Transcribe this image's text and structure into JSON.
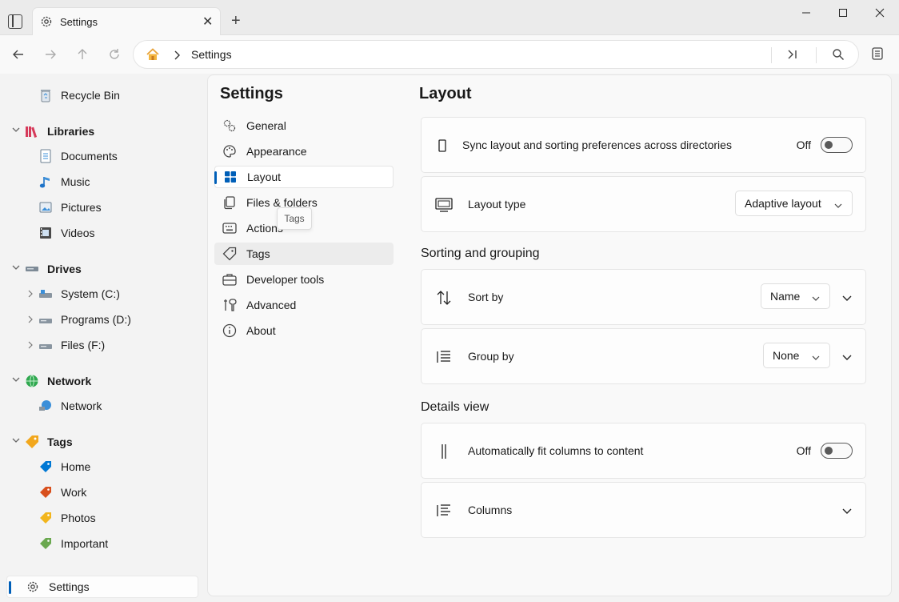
{
  "titlebar": {
    "tab_label": "Settings",
    "close_glyph": "✕",
    "new_tab_glyph": "+"
  },
  "window": {
    "min_glyph": "—",
    "max_glyph": "☐",
    "close_glyph": "✕"
  },
  "address": {
    "crumb": "Settings"
  },
  "sidebar": {
    "recycle_bin": "Recycle Bin",
    "libraries": {
      "label": "Libraries",
      "items": [
        "Documents",
        "Music",
        "Pictures",
        "Videos"
      ]
    },
    "drives": {
      "label": "Drives",
      "items": [
        "System (C:)",
        "Programs (D:)",
        "Files (F:)"
      ]
    },
    "network": {
      "label": "Network",
      "items": [
        "Network"
      ]
    },
    "tags": {
      "label": "Tags",
      "items": [
        "Home",
        "Work",
        "Photos",
        "Important"
      ]
    },
    "settings": "Settings"
  },
  "settings_nav": {
    "title": "Settings",
    "items": [
      "General",
      "Appearance",
      "Layout",
      "Files & folders",
      "Actions",
      "Tags",
      "Developer tools",
      "Advanced",
      "About"
    ],
    "tooltip": "Tags"
  },
  "layout_page": {
    "title": "Layout",
    "sync": {
      "label": "Sync layout and sorting preferences across directories",
      "state": "Off"
    },
    "layout_type": {
      "label": "Layout type",
      "value": "Adaptive layout"
    },
    "sorting_section": "Sorting and grouping",
    "sort_by": {
      "label": "Sort by",
      "value": "Name"
    },
    "group_by": {
      "label": "Group by",
      "value": "None"
    },
    "details_section": "Details view",
    "autofit": {
      "label": "Automatically fit columns to content",
      "state": "Off"
    },
    "columns": {
      "label": "Columns"
    }
  },
  "colors": {
    "accent": "#005fb8",
    "home_tag": "#0078d4",
    "work_tag": "#d84f1c",
    "photos_tag": "#f2b51c",
    "important_tag": "#6aa84f"
  }
}
